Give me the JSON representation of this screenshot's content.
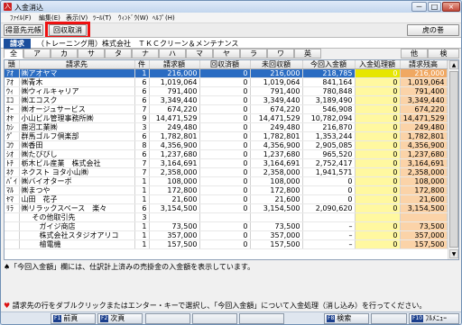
{
  "window": {
    "title": "入金消込",
    "icon_glyph": "入",
    "buttons": [
      "－",
      "□",
      "×"
    ]
  },
  "menu": [
    "ﾌｧｲﾙ(F)",
    "編集(E)",
    "表示(V)",
    "ﾂｰﾙ(T)",
    "ｳｨﾝﾄﾞｳ(W)",
    "ﾍﾙﾌﾟ(H)"
  ],
  "toolbar": {
    "btn1": "得意先元帳",
    "btn2": "回収取消",
    "right": "虎の巻"
  },
  "strip": {
    "mode": "請求",
    "client": "（トレーニング用）株式会社　ＴＫＣクリーン＆メンテナンス"
  },
  "kana_tabs": [
    "全",
    "ア",
    "カ",
    "サ",
    "タ",
    "ナ",
    "ハ",
    "マ",
    "ヤ",
    "ラ",
    "ワ",
    "英",
    "他",
    "検"
  ],
  "columns": [
    "頭",
    "請求先",
    "件",
    "請求額",
    "回収済額",
    "未回収額",
    "今回入金額",
    "入金処理額",
    "請求残高"
  ],
  "rows": [
    {
      "k": "ｱｵ",
      "name": "㈱アオヤマ",
      "n": "1",
      "bill": "216,000",
      "coll": "0",
      "uncoll": "216,000",
      "cur": "218,785",
      "proc": "0",
      "bal": "216,000",
      "sel": true
    },
    {
      "k": "ｱｵ",
      "name": "㈱青木",
      "n": "6",
      "bill": "1,019,064",
      "coll": "0",
      "uncoll": "1,019,064",
      "cur": "841,164",
      "proc": "0",
      "bal": "1,019,064"
    },
    {
      "k": "ｳｨ",
      "name": "㈱ウィルキャリア",
      "n": "6",
      "bill": "791,400",
      "coll": "0",
      "uncoll": "791,400",
      "cur": "780,848",
      "proc": "0",
      "bal": "791,400"
    },
    {
      "k": "ｴｺ",
      "name": "㈱エコスク",
      "n": "6",
      "bill": "3,349,440",
      "coll": "0",
      "uncoll": "3,349,440",
      "cur": "3,189,490",
      "proc": "0",
      "bal": "3,349,440"
    },
    {
      "k": "ｵｰ",
      "name": "㈱オージュサービス",
      "n": "7",
      "bill": "674,220",
      "coll": "0",
      "uncoll": "674,220",
      "cur": "546,908",
      "proc": "0",
      "bal": "674,220"
    },
    {
      "k": "ｵﾔ",
      "name": "小山ビル管理事務所㈱",
      "n": "9",
      "bill": "14,471,529",
      "coll": "0",
      "uncoll": "14,471,529",
      "cur": "10,782,094",
      "proc": "0",
      "bal": "14,471,529"
    },
    {
      "k": "ｶｼ",
      "name": "鹿沼工業㈱",
      "n": "3",
      "bill": "249,480",
      "coll": "0",
      "uncoll": "249,480",
      "cur": "216,870",
      "proc": "0",
      "bal": "249,480"
    },
    {
      "k": "ｸﾞ",
      "name": "群馬ゴルフ倶楽部",
      "n": "6",
      "bill": "1,782,801",
      "coll": "0",
      "uncoll": "1,782,801",
      "cur": "1,353,244",
      "proc": "0",
      "bal": "1,782,801"
    },
    {
      "k": "ｺｳ",
      "name": "㈱香田",
      "n": "8",
      "bill": "4,356,900",
      "coll": "0",
      "uncoll": "4,356,900",
      "cur": "2,905,085",
      "proc": "0",
      "bal": "4,356,900"
    },
    {
      "k": "ｼｵ",
      "name": "㈱たびびし",
      "n": "6",
      "bill": "1,237,680",
      "coll": "0",
      "uncoll": "1,237,680",
      "cur": "965,520",
      "proc": "0",
      "bal": "1,237,680"
    },
    {
      "k": "ﾄﾁ",
      "name": "栃木ビル産業　株式会社",
      "n": "7",
      "bill": "3,164,691",
      "coll": "0",
      "uncoll": "3,164,691",
      "cur": "2,752,417",
      "proc": "0",
      "bal": "3,164,691"
    },
    {
      "k": "ﾈｸ",
      "name": "ネクスト ヨタ小山㈱",
      "n": "7",
      "bill": "2,358,000",
      "coll": "0",
      "uncoll": "2,358,000",
      "cur": "1,941,571",
      "proc": "0",
      "bal": "2,358,000"
    },
    {
      "k": "ﾊﾞｲ",
      "name": "㈱バイオターボ",
      "n": "1",
      "bill": "108,000",
      "coll": "0",
      "uncoll": "108,000",
      "cur": "0",
      "proc": "0",
      "bal": "108,000"
    },
    {
      "k": "ﾏﾙ",
      "name": "㈱まつや",
      "n": "1",
      "bill": "172,800",
      "coll": "0",
      "uncoll": "172,800",
      "cur": "0",
      "proc": "0",
      "bal": "172,800"
    },
    {
      "k": "ﾔﾏ",
      "name": "山田　花子",
      "n": "1",
      "bill": "21,600",
      "coll": "0",
      "uncoll": "21,600",
      "cur": "0",
      "proc": "0",
      "bal": "21,600"
    },
    {
      "k": "ﾘﾗ",
      "name": "㈱リラックスベース　楽々",
      "n": "6",
      "bill": "3,154,500",
      "coll": "0",
      "uncoll": "3,154,500",
      "cur": "2,090,620",
      "proc": "0",
      "bal": "3,154,500"
    },
    {
      "k": "",
      "name": "その他取引先",
      "n": "3",
      "bill": "",
      "coll": "",
      "uncoll": "",
      "cur": "",
      "proc": "",
      "bal": "",
      "sub": 1
    },
    {
      "k": "",
      "name": "ガイジ商店",
      "n": "1",
      "bill": "73,500",
      "coll": "0",
      "uncoll": "73,500",
      "cur": "–",
      "proc": "0",
      "bal": "73,500",
      "sub": 2
    },
    {
      "k": "",
      "name": "株式会社スタジオアリコ",
      "n": "1",
      "bill": "357,000",
      "coll": "0",
      "uncoll": "357,000",
      "cur": "–",
      "proc": "0",
      "bal": "357,000",
      "sub": 2
    },
    {
      "k": "",
      "name": "檜電機",
      "n": "1",
      "bill": "157,500",
      "coll": "0",
      "uncoll": "157,500",
      "cur": "–",
      "proc": "0",
      "bal": "157,500",
      "sub": 2
    }
  ],
  "info": "♠「今回入金額」欄には、仕訳計上済みの売掛金の入金額を表示しています。",
  "hint": "請求先の行をダブルクリックまたはエンター・キーで選択し、「今回入金額」について入金処理（消し込み）を行ってください。",
  "fkeys": [
    {
      "k": "F1",
      "label": "前頁"
    },
    {
      "k": "F2",
      "label": "次頁"
    },
    {
      "k": "",
      "label": ""
    },
    {
      "k": "",
      "label": ""
    },
    {
      "k": "",
      "label": ""
    },
    {
      "k": "F8",
      "label": "検索"
    },
    {
      "k": "",
      "label": ""
    },
    {
      "k": "F10",
      "label": "ﾌﾙﾒﾆｭｰ"
    }
  ]
}
